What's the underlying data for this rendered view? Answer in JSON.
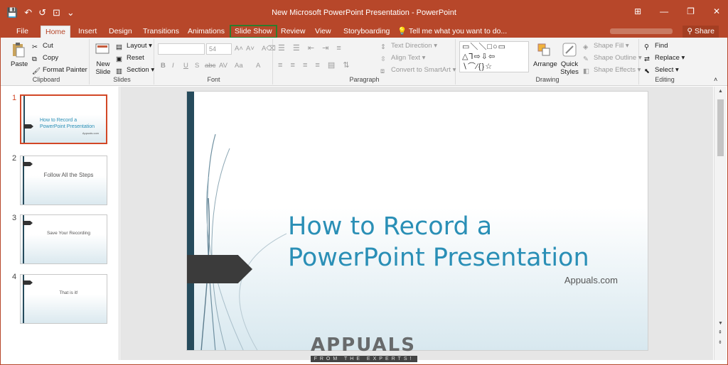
{
  "window": {
    "title": "New Microsoft PowerPoint Presentation - PowerPoint"
  },
  "qat": {
    "save": "💾",
    "undo": "↶",
    "redo": "↺",
    "start": "⊡",
    "more": "⌄"
  },
  "winbtns": {
    "ribbon": "⊞",
    "min": "—",
    "max": "❐",
    "close": "✕"
  },
  "tabs": [
    "File",
    "Home",
    "Insert",
    "Design",
    "Transitions",
    "Animations",
    "Slide Show",
    "Review",
    "View",
    "Storyboarding",
    "Tell me what you want to do..."
  ],
  "share": "Share",
  "ribbon": {
    "clipboard": {
      "label": "Clipboard",
      "paste": "Paste",
      "cut": "Cut",
      "copy": "Copy",
      "format_painter": "Format Painter"
    },
    "slides": {
      "label": "Slides",
      "new_slide": "New Slide",
      "layout": "Layout",
      "reset": "Reset",
      "section": "Section"
    },
    "font": {
      "label": "Font",
      "size": "54",
      "bold": "B",
      "italic": "I",
      "underline": "U",
      "strike": "S",
      "shadow": "abc",
      "spacing": "AV",
      "case": "Aa",
      "color": "A",
      "grow": "A˄",
      "shrink": "A˅",
      "clear": "A⌫"
    },
    "paragraph": {
      "label": "Paragraph",
      "text_direction": "Text Direction",
      "align_text": "Align Text",
      "smartart": "Convert to SmartArt"
    },
    "drawing": {
      "label": "Drawing",
      "arrange": "Arrange",
      "quick_styles": "Quick Styles",
      "shape_fill": "Shape Fill",
      "shape_outline": "Shape Outline",
      "shape_effects": "Shape Effects"
    },
    "editing": {
      "label": "Editing",
      "find": "Find",
      "replace": "Replace",
      "select": "Select"
    }
  },
  "thumbnails": [
    {
      "num": "1",
      "title": "How to Record a PowerPoint Presentation",
      "sub": "Appuals.com"
    },
    {
      "num": "2",
      "title": "Follow All the Steps"
    },
    {
      "num": "3",
      "title": "Save Your Recording"
    },
    {
      "num": "4",
      "title": "That is it!"
    }
  ],
  "slide": {
    "title": "How to Record a PowerPoint Presentation",
    "subtitle": "Appuals.com"
  },
  "watermark": {
    "brand": "APPUALS",
    "tagline": "FROM THE EXPERTS!"
  }
}
